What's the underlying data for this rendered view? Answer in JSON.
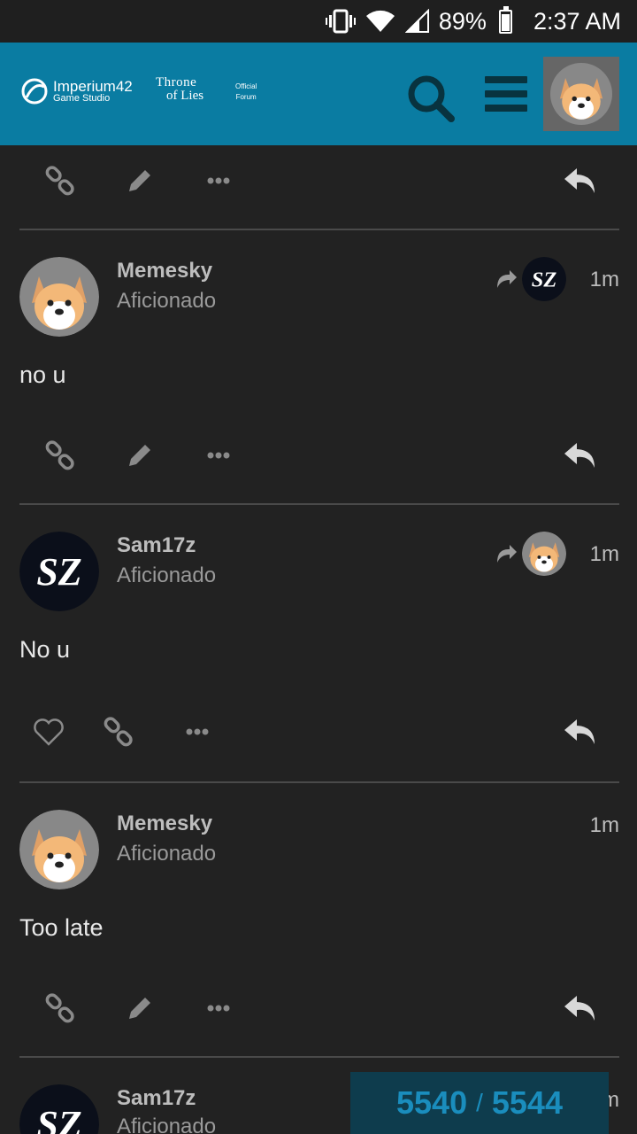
{
  "status_bar": {
    "battery": "89%",
    "time": "2:37 AM",
    "icons": [
      "vibrate-icon",
      "wifi-icon",
      "signal-icon",
      "battery-icon"
    ]
  },
  "header": {
    "logo1_line1": "Imperium42",
    "logo1_line2": "Game Studio",
    "logo2_line1": "Throne",
    "logo2_line2": "of Lies",
    "logo3_line1": "Official",
    "logo3_line2": "Forum"
  },
  "posts": [
    {
      "user": "Memesky",
      "role": "Aficionado",
      "time": "1m",
      "body": "no u"
    },
    {
      "user": "Sam17z",
      "role": "Aficionado",
      "time": "1m",
      "body": "No u"
    },
    {
      "user": "Memesky",
      "role": "Aficionado",
      "time": "1m",
      "body": "Too late"
    },
    {
      "user": "Sam17z",
      "role": "Aficionado",
      "time": "1m",
      "body": ""
    }
  ],
  "progress": {
    "current": "5540",
    "separator": "/",
    "total": "5544"
  },
  "colors": {
    "header": "#0a7ca2",
    "background": "#222222",
    "accent": "#1a8dbd"
  }
}
